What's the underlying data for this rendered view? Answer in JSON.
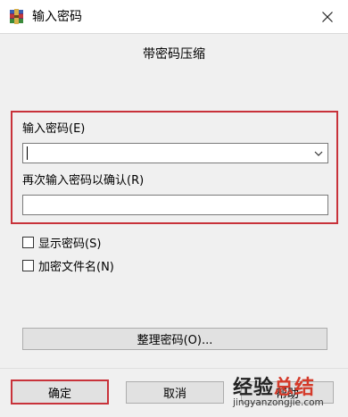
{
  "window": {
    "title": "输入密码",
    "close_icon": "close-icon",
    "app_icon": "winrar-icon"
  },
  "dialog": {
    "heading": "带密码压缩",
    "password_label": "输入密码(E)",
    "password_value": "",
    "repeat_label": "再次输入密码以确认(R)",
    "repeat_value": "",
    "show_password_label": "显示密码(S)",
    "show_password_checked": false,
    "encrypt_names_label": "加密文件名(N)",
    "encrypt_names_checked": false,
    "organize_button": "整理密码(O)..."
  },
  "footer": {
    "ok_button": "确定",
    "cancel_button": "取消",
    "help_button": "帮助"
  },
  "watermark": {
    "main_black": "经验",
    "main_red": "总结",
    "sub": "jingyanzongjie.com"
  },
  "colors": {
    "highlight": "#c8323a",
    "dialog_bg": "#f0f0f0",
    "button_bg": "#e1e1e1"
  }
}
